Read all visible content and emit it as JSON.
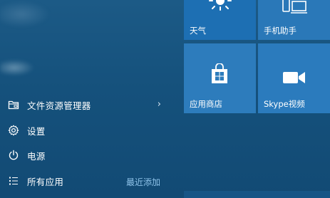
{
  "menu": {
    "items": [
      {
        "label": "文件资源管理器",
        "icon": "file-explorer-icon",
        "has_submenu": true
      },
      {
        "label": "设置",
        "icon": "settings-gear-icon",
        "has_submenu": false
      },
      {
        "label": "电源",
        "icon": "power-icon",
        "has_submenu": false
      },
      {
        "label": "所有应用",
        "icon": "all-apps-list-icon",
        "has_submenu": false
      }
    ],
    "recent_label": "最近添加"
  },
  "tiles": {
    "weather": {
      "label": "天气",
      "icon": "weather-sun-icon"
    },
    "phone": {
      "label": "手机助手",
      "icon": "phone-companion-icon"
    },
    "store": {
      "label": "应用商店",
      "icon": "store-bag-icon"
    },
    "skype": {
      "label": "Skype视频",
      "icon": "video-camera-icon"
    }
  },
  "colors": {
    "background": "#15517c",
    "tile": "#2a78b8",
    "accent_text": "#8fc4ea"
  }
}
